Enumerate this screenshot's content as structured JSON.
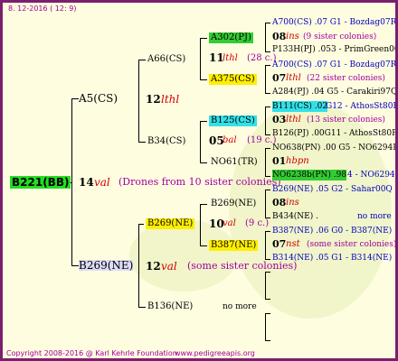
{
  "header": {
    "date": "8. 12-2016 ( 12:  9)"
  },
  "footer": {
    "copyright": "Copyright 2008-2016 @ Karl Kehrle Foundation.",
    "site": "www.pedigreeapis.org"
  },
  "colors": {
    "border": "#7a1f6e",
    "background": "#fffde0",
    "green": "#33cc33",
    "yellow": "#ffee00",
    "cyan": "#33e0e8",
    "lavender": "#dcdcf6"
  },
  "root": {
    "id": "B221(BB)",
    "year": "14",
    "note": "val",
    "drones": "(Drones from 10 sister colonies)"
  },
  "gen1": {
    "upper": {
      "id": "A5(CS)",
      "year": "12",
      "note": "lthl"
    },
    "lower": {
      "id": "B269(NE)",
      "year": "12",
      "note": "val",
      "sis": "(some sister colonies)"
    }
  },
  "gen2": {
    "a66": {
      "id": "A66(CS)",
      "year": "11",
      "note": "lthl",
      "sis": "(28 c.)"
    },
    "b34": {
      "id": "B34(CS)",
      "year": "05",
      "note": "bal",
      "sis": "(19 c.)"
    },
    "b269": {
      "id": "B269(NE)",
      "year": "10",
      "note": "val",
      "sis": "(9 c.)"
    },
    "b136": {
      "id": "B136(NE)",
      "nomore": "no more"
    }
  },
  "gen3": {
    "a302": {
      "id": "A302(PJ)",
      "year": "08",
      "note": "ins",
      "sis": "(9 sister colonies)"
    },
    "a375": {
      "id": "A375(CS)",
      "year": "07",
      "note": "lthl",
      "sis": "(22 sister colonies)"
    },
    "b125": {
      "id": "B125(CS)",
      "year": "03",
      "note": "lthl",
      "sis": "(13 sister colonies)"
    },
    "no61": {
      "id": "NO61(TR)",
      "year": "01",
      "note": "hbpn"
    },
    "b269": {
      "id": "B269(NE)",
      "year": "08",
      "note": "ins"
    },
    "b387": {
      "id": "B387(NE)",
      "year": "07",
      "note": "nst",
      "sis": "(some sister colonies)"
    }
  },
  "gen4": {
    "a700a": "A700(CS) .07  G1 - Bozdag07R",
    "p133": "P133H(PJ) .053 - PrimGreen00",
    "a700b": "A700(CS) .07  G1 - Bozdag07R",
    "a284": "A284(PJ) .04  G5 - Carakiri97Q",
    "b111": "B111(CS) .02",
    "b111b": "G12 - AthosSt80R",
    "b126": "B126(PJ) .00G11 - AthosSt80R",
    "no638": "NO638(PN) .00  G5 - NO6294R",
    "no6238": "NO6238b(PN) .98",
    "no6238b": "4 - NO6294R",
    "b269": "B269(NE) .05    G2 - Sahar00Q",
    "b434": "B434(NE) .",
    "b434b": "no more",
    "b387": "B387(NE) .06    G0 - B387(NE)",
    "b314": "B314(NE) .05    G1 - B314(NE)"
  },
  "empty_nomore": "no more"
}
